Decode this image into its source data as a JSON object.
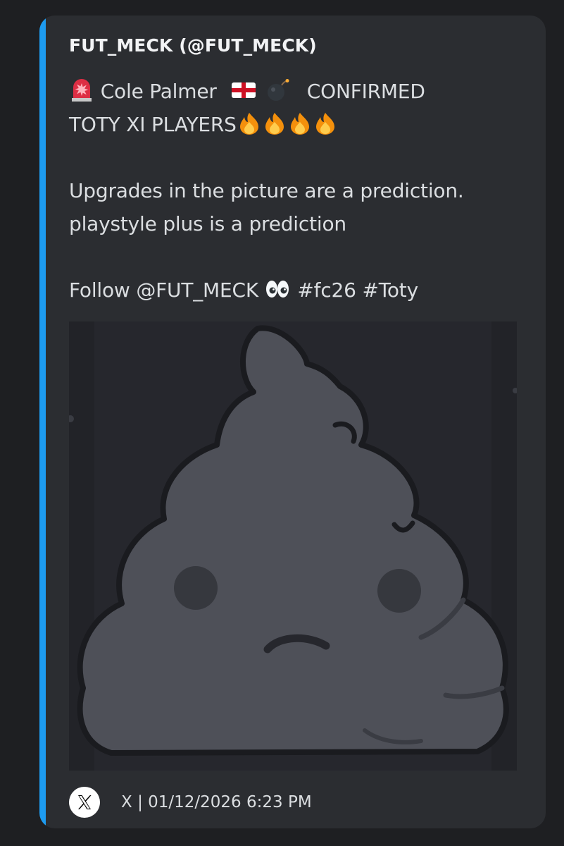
{
  "embed": {
    "accent_color": "#1d9bf0",
    "author": "FUT_MECK (@FUT_MECK)",
    "description": {
      "line1_name": "Cole Palmer",
      "line1_status": "CONFIRMED",
      "line2": "TOTY XI PLAYERS",
      "line3": "Upgrades in the picture are a prediction.",
      "line4": "playstyle plus is a prediction",
      "line5_follow": "Follow @FUT_MECK",
      "line5_tags": "#fc26 #Toty"
    },
    "emojis": [
      "rotating-light",
      "england-flag",
      "bomb",
      "fire",
      "fire",
      "fire",
      "fire",
      "eyes"
    ],
    "image": {
      "icon": "poop-frown-placeholder"
    },
    "footer": {
      "icon": "x-logo",
      "text": "X | 01/12/2026 6:23 PM"
    }
  }
}
